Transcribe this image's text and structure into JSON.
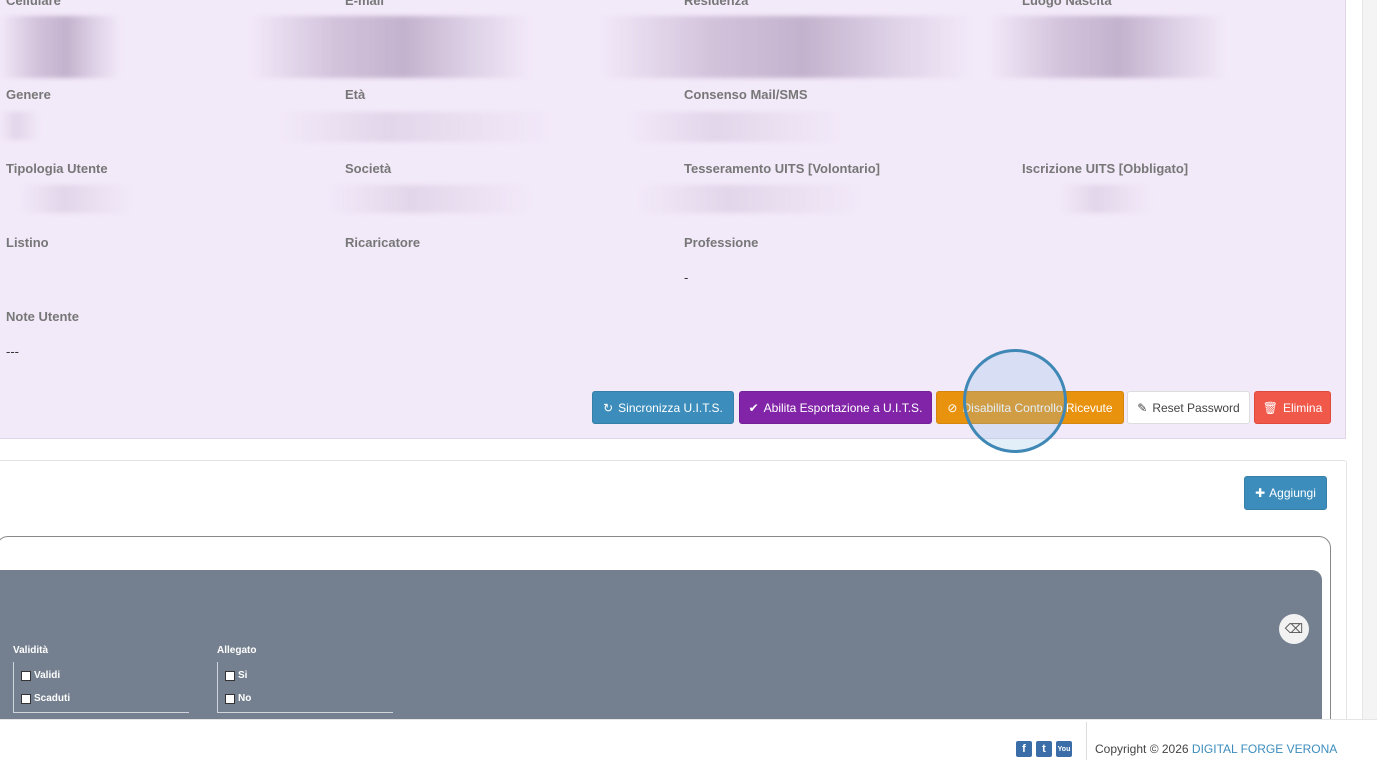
{
  "profile": {
    "row1": {
      "cellulare": "Cellulare",
      "email": "E-mail",
      "residenza": "Residenza",
      "luogo_nascita": "Luogo Nascita"
    },
    "row2": {
      "genere": "Genere",
      "eta": "Età",
      "consenso": "Consenso Mail/SMS"
    },
    "row3": {
      "tipologia": "Tipologia Utente",
      "societa": "Società",
      "tesseramento": "Tesseramento UITS [Volontario]",
      "iscrizione": "Iscrizione UITS [Obbligato]"
    },
    "row4": {
      "listino": "Listino",
      "ricaricatore": "Ricaricatore",
      "professione": "Professione",
      "professione_value": "-"
    },
    "row5": {
      "note": "Note Utente",
      "note_value": "---"
    },
    "actions": {
      "sync": "Sincronizza U.I.T.S.",
      "export": "Abilita Esportazione a U.I.T.S.",
      "disable": "Disabilita Controllo Ricevute",
      "reset": "Reset Password",
      "delete": "Elimina"
    }
  },
  "documents": {
    "add": "Aggiungi",
    "filters": {
      "validita": {
        "title": "Validità",
        "options": [
          "Validi",
          "Scaduti"
        ]
      },
      "allegato": {
        "title": "Allegato",
        "options": [
          "Si",
          "No"
        ]
      }
    }
  },
  "footer": {
    "copyright": "Copyright © 2026",
    "company": "DIGITAL FORGE VERONA"
  },
  "colors": {
    "profile_bg": "#f2e9f9",
    "sync": "#3c8dbc",
    "export": "#8224a8",
    "disable": "#e9920e",
    "delete": "#f0584a",
    "filter_bg": "#74808f"
  },
  "icons": [
    "refresh-icon",
    "check-icon",
    "ban-icon",
    "pencil-icon",
    "trash-icon",
    "plus-icon",
    "eraser-icon",
    "facebook-icon",
    "twitter-icon",
    "youtube-icon"
  ]
}
